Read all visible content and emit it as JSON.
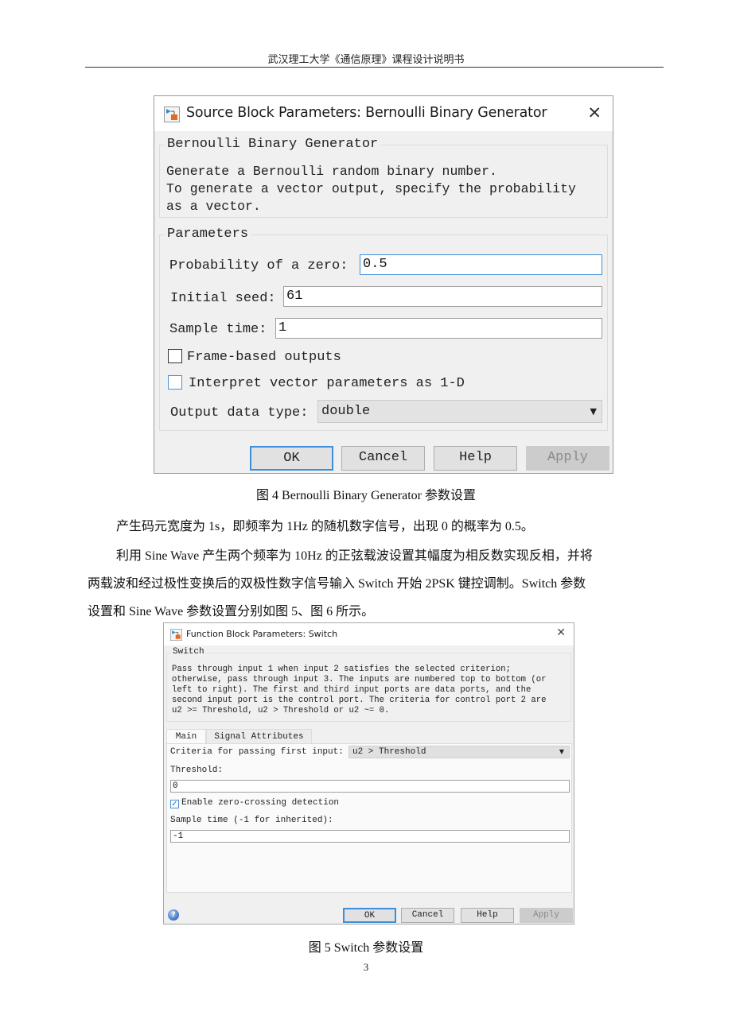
{
  "page": {
    "header": "武汉理工大学《通信原理》课程设计说明书",
    "page_number": "3"
  },
  "dialog1": {
    "title": "Source Block Parameters: Bernoulli Binary Generator",
    "icon": "simulink-block-icon",
    "close_icon": "close-icon",
    "description_group": {
      "legend": "Bernoulli Binary Generator",
      "text": "Generate a Bernoulli random binary number.\nTo generate a vector output, specify the probability\nas a vector."
    },
    "parameters_group": {
      "legend": "Parameters",
      "probability_label": "Probability of a zero:",
      "probability_value": "0.5",
      "seed_label": "Initial seed:",
      "seed_value": "61",
      "sample_time_label": "Sample time:",
      "sample_time_value": "1",
      "frame_based_label": "Frame-based outputs",
      "frame_based_checked": false,
      "interpret_label": "Interpret vector parameters as 1-D",
      "interpret_checked": false,
      "output_type_label": "Output data type:",
      "output_type_value": "double"
    },
    "buttons": {
      "ok": "OK",
      "cancel": "Cancel",
      "help": "Help",
      "apply": "Apply"
    }
  },
  "caption4": "图 4 Bernoulli Binary Generator 参数设置",
  "paragraphs": [
    "产生码元宽度为 1s，即频率为 1Hz 的随机数字信号，出现 0 的概率为 0.5。",
    "利用 Sine Wave 产生两个频率为 10Hz 的正弦载波设置其幅度为相反数实现反相，并将",
    "两载波和经过极性变换后的双极性数字信号输入 Switch 开始 2PSK 键控调制。Switch 参数",
    "设置和 Sine Wave 参数设置分别如图 5、图 6 所示。"
  ],
  "dialog2": {
    "title": "Function Block Parameters: Switch",
    "icon": "simulink-block-icon",
    "close_icon": "close-icon",
    "description_group": {
      "legend": "Switch",
      "text": "Pass through input 1 when input 2 satisfies the selected criterion;\notherwise, pass through input 3. The inputs are numbered top to bottom (or\nleft to right). The first and third input ports are data ports, and the\nsecond input port is the control port. The criteria for control port 2 are\nu2 >= Threshold, u2 > Threshold or u2 ~= 0."
    },
    "tabs": [
      "Main",
      "Signal Attributes"
    ],
    "active_tab": "Main",
    "criteria_label": "Criteria for passing first input:",
    "criteria_value": "u2 > Threshold",
    "threshold_label": "Threshold:",
    "threshold_value": "0",
    "zero_crossing_label": "Enable zero-crossing detection",
    "zero_crossing_checked": true,
    "sample_time_label": "Sample time (-1 for inherited):",
    "sample_time_value": "-1",
    "help_icon": "help-icon",
    "buttons": {
      "ok": "OK",
      "cancel": "Cancel",
      "help": "Help",
      "apply": "Apply"
    }
  },
  "caption5": "图 5 Switch 参数设置"
}
